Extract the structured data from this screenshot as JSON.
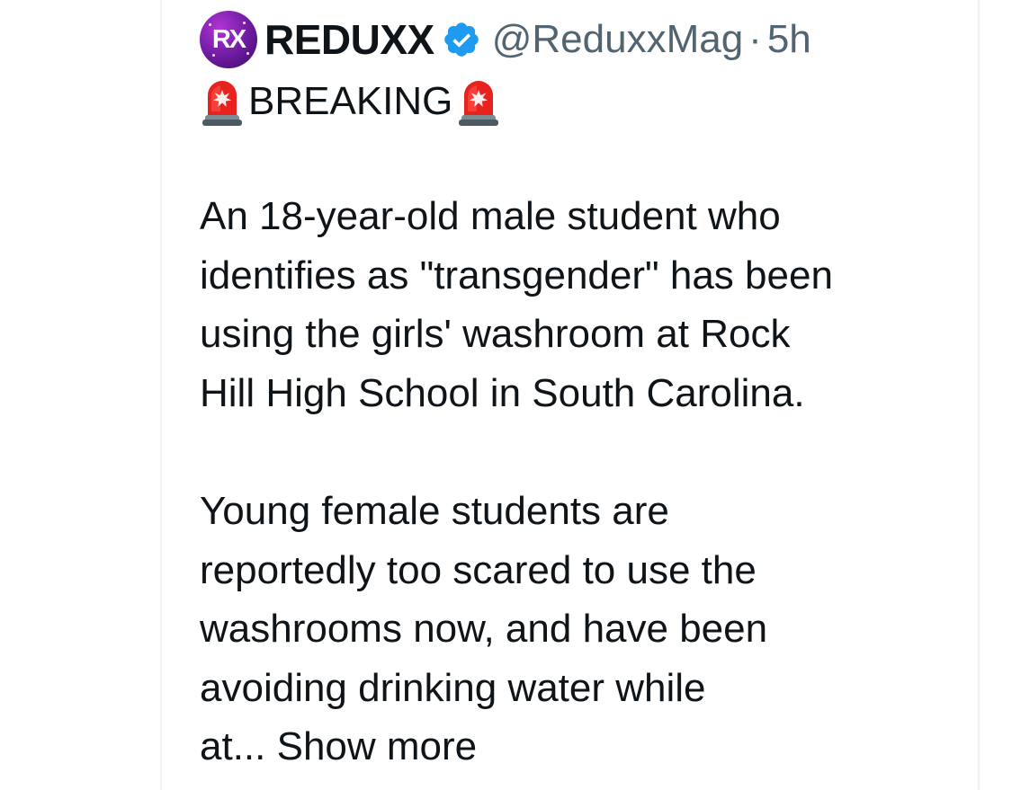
{
  "tweet": {
    "display_name": "REDUXX",
    "avatar_monogram": "RX",
    "handle": "@ReduxxMag",
    "separator": "·",
    "timestamp": "5h",
    "breaking_label": "BREAKING",
    "paragraph1_lines": [
      "An 18-year-old male student who",
      "identifies as \"transgender\" has been",
      "using the girls' washroom at Rock",
      "Hill High School in South Carolina."
    ],
    "paragraph2_lines": [
      "Young female students are",
      "reportedly too scared to use the",
      "washrooms now, and have been",
      "avoiding drinking water while"
    ],
    "last_line_prefix": "at...",
    "show_more": "Show more"
  },
  "colors": {
    "text": "#0f1419",
    "secondary": "#536471",
    "verified": "#1d9bf0",
    "divider": "#eff3f4",
    "siren_red": "#e8231f"
  },
  "icons": {
    "verified": "verified-badge-icon",
    "siren": "police-car-light-emoji"
  }
}
